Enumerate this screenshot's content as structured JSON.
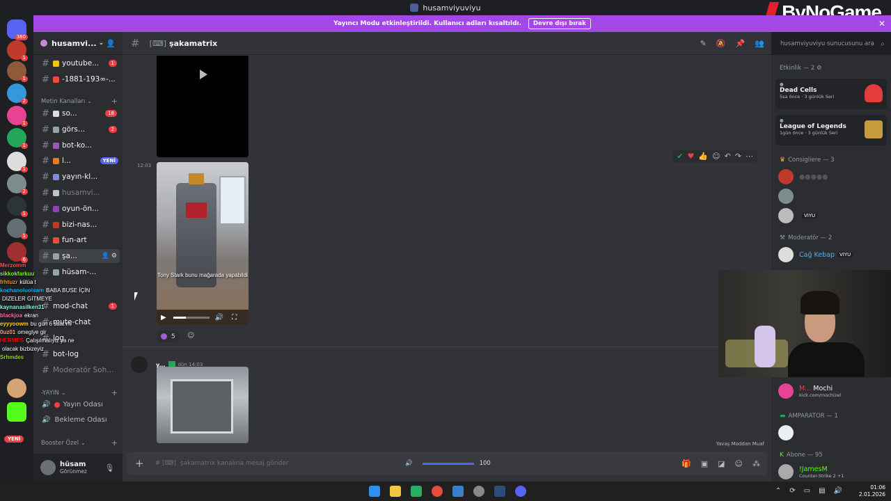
{
  "window": {
    "title": "husamviyuviyu"
  },
  "watermark": "ByNoGame",
  "banner": {
    "text": "Yayıncı Modu etkinleştirildi. Kullanıcı adları kısaltıldı.",
    "button": "Devre dışı bırak"
  },
  "rail": {
    "top_badge": "360",
    "badges": [
      "1",
      "1",
      "2",
      "1",
      "1",
      "1",
      "2",
      "1",
      "1",
      "6"
    ],
    "new_label": "YENİ"
  },
  "guild": {
    "name": "husamvi..."
  },
  "channels_top": [
    {
      "name": "youtube...",
      "badge": "1"
    },
    {
      "name": "-1881-193∞-..."
    }
  ],
  "category_text": "Metin Kanalları",
  "channels": [
    {
      "name": "so...",
      "badge": "18"
    },
    {
      "name": "görs...",
      "badge": "2"
    },
    {
      "name": "bot-ko..."
    },
    {
      "name": "l...",
      "new": "YENİ"
    },
    {
      "name": "yayın-kl..."
    },
    {
      "name": "husamvi...",
      "muted": true
    },
    {
      "name": "oyun-ön..."
    },
    {
      "name": "bizi-nas..."
    },
    {
      "name": "fun-art"
    },
    {
      "name": "şa...",
      "active": true
    },
    {
      "name": "hüsam-..."
    }
  ],
  "channels_lower": [
    {
      "name": "mod-chat",
      "badge": "1"
    },
    {
      "name": "mute-chat"
    },
    {
      "name": "log"
    },
    {
      "name": "bot-log"
    },
    {
      "name": "Moderatör Soh..."
    }
  ],
  "category_voice": "-YAYIN",
  "voice_channels": [
    "Yayın Odası",
    "Bekleme Odası"
  ],
  "category_booster": "Booster Özel",
  "user": {
    "name": "hüsam",
    "status": "Görünmez"
  },
  "chat_overlay": [
    {
      "user": "Merzomm",
      "text": ""
    },
    {
      "user": "sikkokfarkuu",
      "text": ""
    },
    {
      "user": "frhtuzr",
      "text": "külüa t"
    },
    {
      "user": "kochanoluolsam",
      "text": "BABA BUSE İÇİN"
    },
    {
      "user": "",
      "text": "DİZELER GİTMEYE"
    },
    {
      "user": "kaynanasilken31",
      "text": ""
    },
    {
      "user": "blackjoa",
      "text": "ekran"
    },
    {
      "user": "eyyyoowm",
      "text": "bu gün 6 saat mi"
    },
    {
      "user": "0uz01",
      "text": "omeglye gir"
    },
    {
      "user": "HERMES",
      "text": "Çalışılmalıyız ya ne"
    },
    {
      "user": "",
      "text": "olacak bizbizeyiz"
    },
    {
      "user": "Srhmdes",
      "text": ""
    }
  ],
  "main": {
    "channel_title": "şakamatrix",
    "search_placeholder": "husamviyuviyu sunucusunu ara",
    "time1": "12:03",
    "caption": "Tony Stark bunu mağarada yapabildi",
    "reaction_count": "5",
    "msg2_author": "y...",
    "msg2_time": "dün 14:03",
    "slowmode": "Yavaş Moddan Muaf",
    "composer_placeholder": "şakamatrix kanalına mesaj gönder",
    "volume": "100"
  },
  "members": {
    "activity_header": "Etkinlik — 2",
    "activities": [
      {
        "game": "Dead Cells",
        "meta1": "5sa önce",
        "meta2": "3 günlük Seri"
      },
      {
        "game": "League of Legends",
        "meta1": "1gün önce",
        "meta2": "3 günlük Seri"
      }
    ],
    "consigliere_header": "Consigliere — 3",
    "viyu_tag": "VIYU",
    "moderator_header": "Moderatör — 2",
    "moderator_member": "Cağ Kebap",
    "mochi_name": "Mochi",
    "mochi_sub": "kick.com/mochizel",
    "amparator_header": "AMPARATOR — 1",
    "abone_header": "Abone — 95",
    "abone_member": "!JamesM",
    "abone_sub": "Counter-Strike 2 +1"
  },
  "taskbar": {
    "time": "01:06",
    "date": "2.01.2026"
  }
}
